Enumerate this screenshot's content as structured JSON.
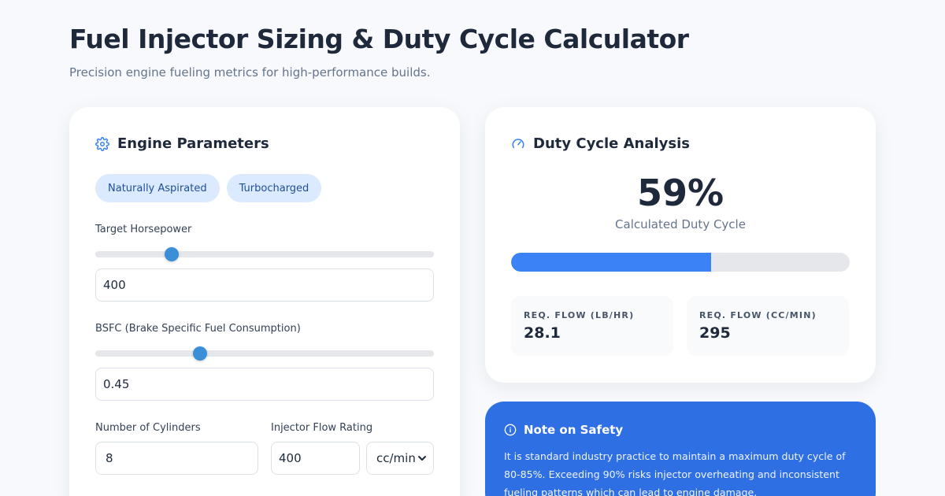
{
  "header": {
    "title": "Fuel Injector Sizing & Duty Cycle Calculator",
    "subtitle": "Precision engine fueling metrics for high-performance builds."
  },
  "params": {
    "title": "Engine Parameters",
    "icon": "gear-icon",
    "modes": [
      "Naturally Aspirated",
      "Turbocharged"
    ],
    "horsepower": {
      "label": "Target Horsepower",
      "value": "400",
      "slider_fraction": 0.225
    },
    "bsfc": {
      "label": "BSFC (Brake Specific Fuel Consumption)",
      "value": "0.45",
      "slider_fraction": 0.31
    },
    "cylinders": {
      "label": "Number of Cylinders",
      "value": "8"
    },
    "injector": {
      "label": "Injector Flow Rating",
      "value": "400",
      "unit": "cc/min"
    }
  },
  "analysis": {
    "title": "Duty Cycle Analysis",
    "icon": "gauge-icon",
    "duty_cycle": "59%",
    "duty_caption": "Calculated Duty Cycle",
    "duty_fraction": 0.59,
    "flow_lb": {
      "label": "REQ. FLOW (LB/HR)",
      "value": "28.1"
    },
    "flow_cc": {
      "label": "REQ. FLOW (CC/MIN)",
      "value": "295"
    }
  },
  "safety": {
    "title": "Note on Safety",
    "icon": "info-icon",
    "text": "It is standard industry practice to maintain a maximum duty cycle of 80-85%. Exceeding 90% risks injector overheating and inconsistent fueling patterns which can lead to engine damage."
  },
  "colors": {
    "accent": "#3b82f6",
    "safety_bg": "#2f6fe4",
    "pill_bg": "#dbeafe"
  }
}
